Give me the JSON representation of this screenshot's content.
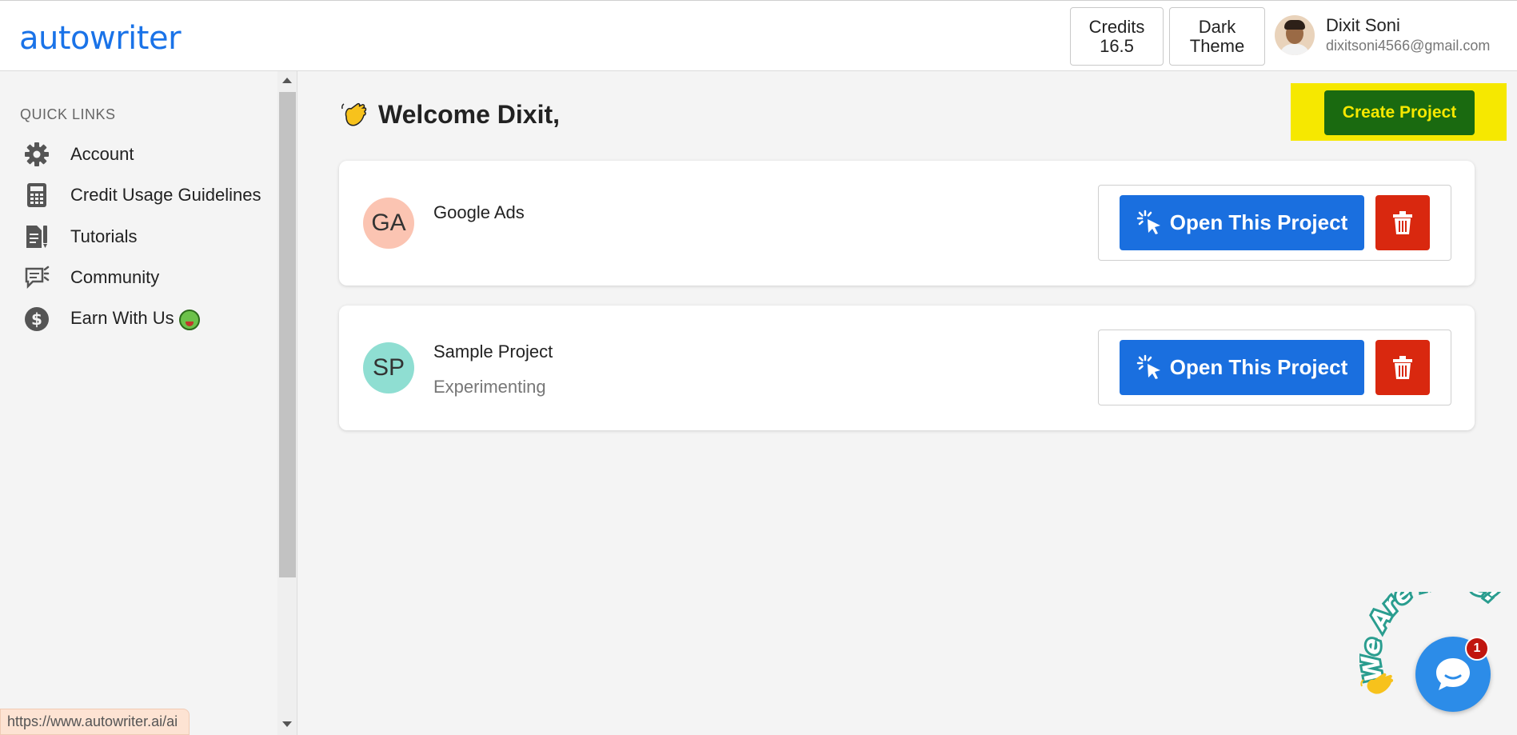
{
  "header": {
    "logo": "autowriter",
    "credits_label": "Credits",
    "credits_value": "16.5",
    "theme_line1": "Dark",
    "theme_line2": "Theme",
    "user_name": "Dixit Soni",
    "user_email": "dixitsoni4566@gmail.com"
  },
  "sidebar": {
    "title": "QUICK LINKS",
    "items": [
      {
        "label": "Account",
        "icon": "gear-icon"
      },
      {
        "label": "Credit Usage Guidelines",
        "icon": "calculator-icon"
      },
      {
        "label": "Tutorials",
        "icon": "document-icon"
      },
      {
        "label": "Community",
        "icon": "chat-icon"
      },
      {
        "label": "Earn With Us",
        "icon": "dollar-icon"
      }
    ]
  },
  "main": {
    "welcome": "Welcome Dixit,",
    "create_button": "Create Project",
    "projects": [
      {
        "initials": "GA",
        "name": "Google Ads",
        "description": "",
        "avatar_color": "#fbc4b2",
        "open_label": "Open This Project"
      },
      {
        "initials": "SP",
        "name": "Sample Project",
        "description": "Experimenting",
        "avatar_color": "#8fded2",
        "open_label": "Open This Project"
      }
    ]
  },
  "status_bar": {
    "url": "https://www.autowriter.ai/ai"
  },
  "chat": {
    "tagline": "We Are Here!",
    "badge_count": "1"
  },
  "colors": {
    "brand": "#1a73e8",
    "create_button": "#1a6a10",
    "highlight": "#f6e800",
    "open_button": "#1a6fdf",
    "delete_button": "#d9280f"
  }
}
